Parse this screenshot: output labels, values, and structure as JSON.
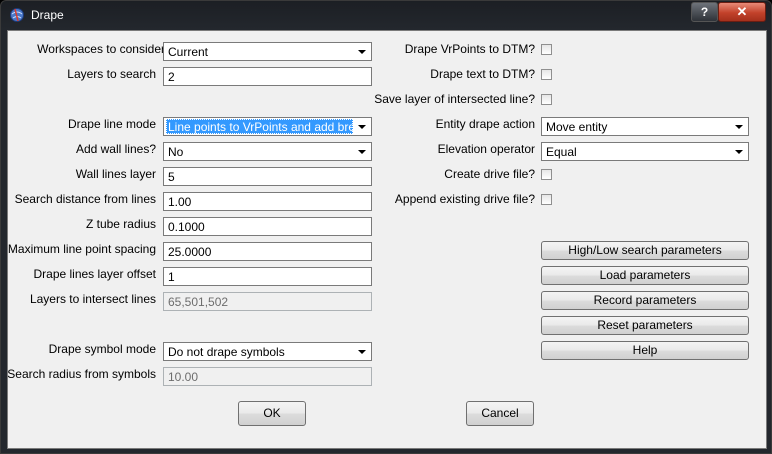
{
  "window": {
    "title": "Drape",
    "help_label": "?",
    "close_label": "✕",
    "icon": "app-globe-icon"
  },
  "left_fields": {
    "workspaces": {
      "label": "Workspaces to consider",
      "value": "Current"
    },
    "layers_to_search": {
      "label": "Layers to search",
      "value": "2"
    },
    "drape_line_mode": {
      "label": "Drape line mode",
      "value": "Line points to VrPoints and add breaks"
    },
    "add_wall_lines": {
      "label": "Add wall lines?",
      "value": "No"
    },
    "wall_lines_layer": {
      "label": "Wall lines layer",
      "value": "5"
    },
    "search_distance": {
      "label": "Search distance from lines",
      "value": "1.00"
    },
    "z_tube_radius": {
      "label": "Z tube radius",
      "value": "0.1000"
    },
    "max_line_point_spacing": {
      "label": "Maximum line point spacing",
      "value": "25.0000"
    },
    "drape_lines_layer_offset": {
      "label": "Drape lines layer offset",
      "value": "1"
    },
    "layers_to_intersect": {
      "label": "Layers to intersect lines",
      "value": "65,501,502"
    },
    "drape_symbol_mode": {
      "label": "Drape symbol mode",
      "value": "Do not drape symbols"
    },
    "search_radius_symbols": {
      "label": "Search radius from symbols",
      "value": "10.00"
    }
  },
  "right_fields": {
    "drape_vrpoints": {
      "label": "Drape VrPoints to DTM?",
      "checked": false
    },
    "drape_text": {
      "label": "Drape text to DTM?",
      "checked": false
    },
    "save_layer": {
      "label": "Save layer of intersected line?",
      "checked": false
    },
    "entity_drape_action": {
      "label": "Entity drape action",
      "value": "Move entity"
    },
    "elevation_operator": {
      "label": "Elevation operator",
      "value": "Equal"
    },
    "create_drive_file": {
      "label": "Create drive file?",
      "checked": false
    },
    "append_drive_file": {
      "label": "Append existing drive file?",
      "checked": false
    }
  },
  "buttons": {
    "high_low": "High/Low search parameters",
    "load": "Load parameters",
    "record": "Record parameters",
    "reset": "Reset parameters",
    "help": "Help",
    "ok": "OK",
    "cancel": "Cancel"
  }
}
